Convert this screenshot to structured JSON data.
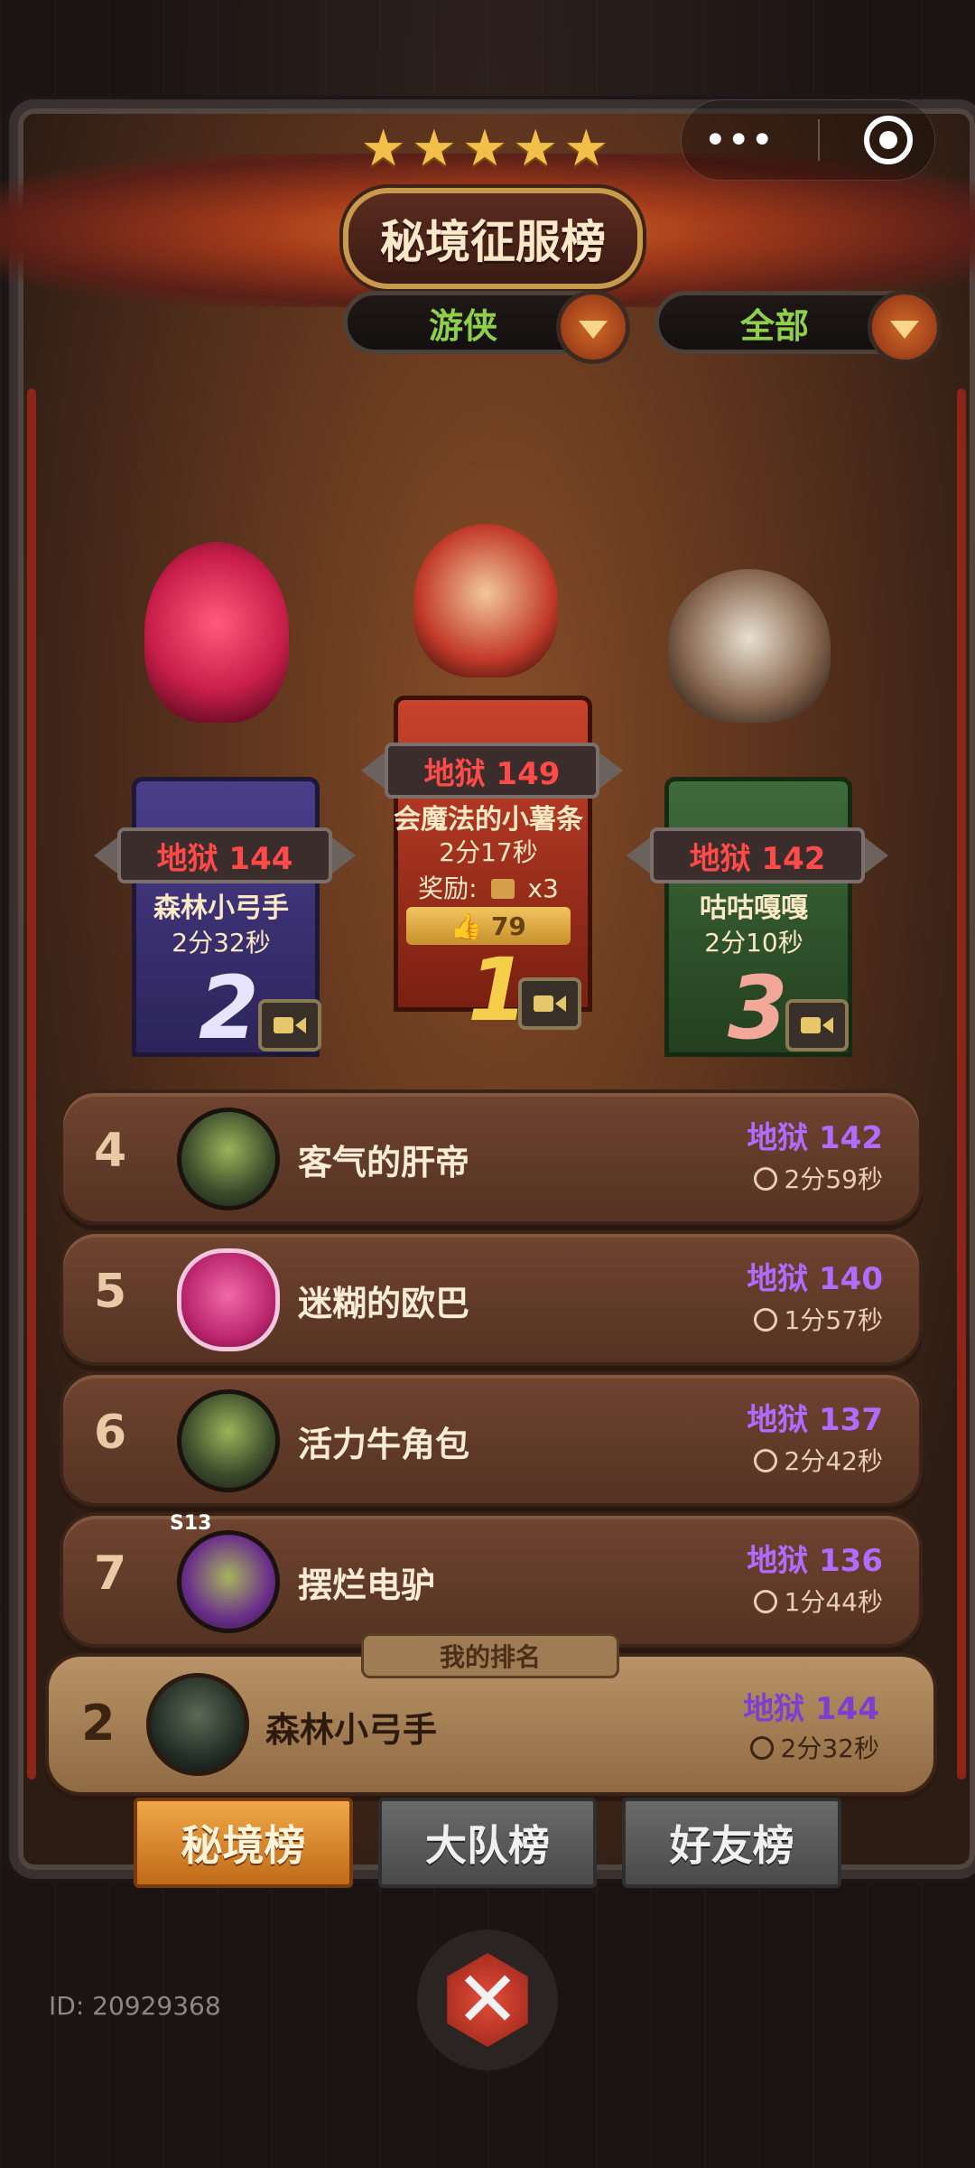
{
  "header": {
    "title": "秘境征服榜",
    "stars": "★★★★★",
    "menu_dots": "•••",
    "class_filter": "游侠",
    "scope_filter": "全部"
  },
  "podium": [
    {
      "rank": "2",
      "level": "地狱 144",
      "name": "森林小弓手",
      "time": "2分32秒",
      "color": "#3f3474"
    },
    {
      "rank": "1",
      "level": "地狱 149",
      "name": "会魔法的小薯条",
      "time": "2分17秒",
      "reward_label": "奖励:",
      "reward_count": "x3",
      "likes": "79",
      "color": "#b23822"
    },
    {
      "rank": "3",
      "level": "地狱 142",
      "name": "咕咕嘎嘎",
      "time": "2分10秒",
      "color": "#2f4a2a"
    }
  ],
  "list": [
    {
      "rank": "4",
      "name": "客气的肝帝",
      "level": "地狱 142",
      "time": "2分59秒"
    },
    {
      "rank": "5",
      "name": "迷糊的欧巴",
      "level": "地狱 140",
      "time": "1分57秒"
    },
    {
      "rank": "6",
      "name": "活力牛角包",
      "level": "地狱 137",
      "time": "2分42秒"
    },
    {
      "rank": "7",
      "name": "摆烂电驴",
      "level": "地狱 136",
      "time": "1分44秒",
      "badge": "S13"
    }
  ],
  "my_rank": {
    "label": "我的排名",
    "rank": "2",
    "name": "森林小弓手",
    "level": "地狱 144",
    "time": "2分32秒"
  },
  "tabs": [
    "秘境榜",
    "大队榜",
    "好友榜"
  ],
  "close_glyph": "✕",
  "footer_id": "ID: 20929368",
  "colors": {
    "hell_red": "#ff4a4a",
    "level_purple": "#b26bff",
    "filter_green": "#8fd04b",
    "tab_active": "#e08a2a"
  }
}
